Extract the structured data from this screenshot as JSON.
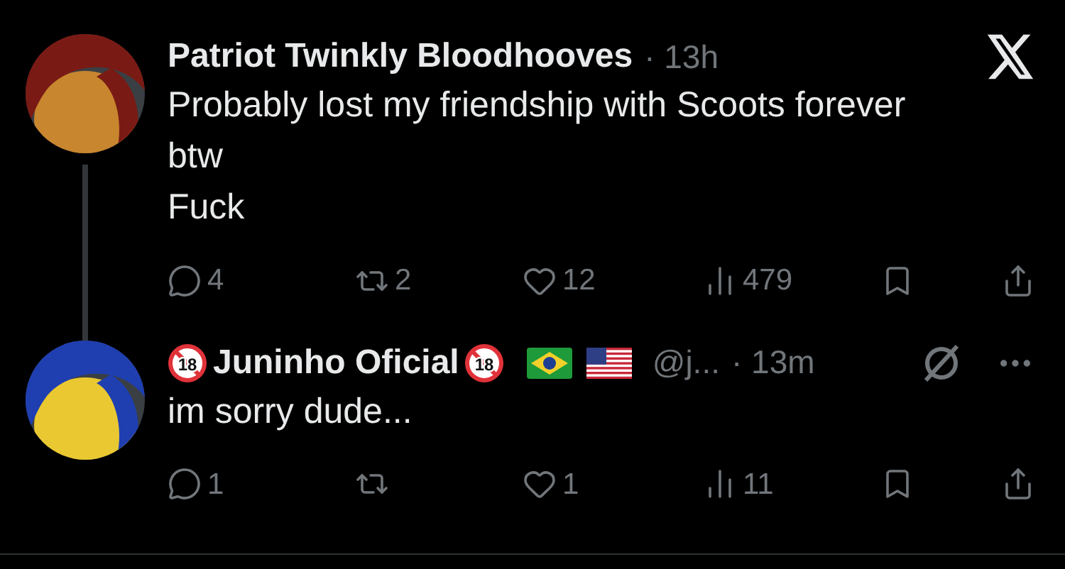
{
  "posts": [
    {
      "avatar": {
        "kind": "picture"
      },
      "name": "Patriot Twinkly Bloodhooves",
      "time": "· 13h",
      "corner": {
        "kind": "x-logo"
      },
      "thread_line": true,
      "body": [
        "Probably lost my friendship with Scoots forever",
        "btw",
        "Fuck"
      ],
      "actions": [
        {
          "kind": "reply",
          "count": "4"
        },
        {
          "kind": "repost",
          "count": "2"
        },
        {
          "kind": "like",
          "count": "12"
        },
        {
          "kind": "views",
          "count": "479"
        },
        {
          "kind": "bookmark"
        },
        {
          "kind": "share"
        }
      ]
    },
    {
      "avatar": {
        "kind": "picture"
      },
      "badge_before": "18",
      "name": "Juninho Oficial",
      "badge_after": "18",
      "flags": [
        {
          "kind": "brazil"
        },
        {
          "kind": "usa"
        }
      ],
      "handle": "@j...",
      "time": "· 13m",
      "corner": {
        "kind": "slashed-circle"
      },
      "thread_line": false,
      "body": [
        "im sorry dude..."
      ],
      "actions": [
        {
          "kind": "reply",
          "count": "1"
        },
        {
          "kind": "repost"
        },
        {
          "kind": "like",
          "count": "1"
        },
        {
          "kind": "views",
          "count": "11"
        },
        {
          "kind": "bookmark"
        },
        {
          "kind": "share"
        }
      ]
    }
  ]
}
